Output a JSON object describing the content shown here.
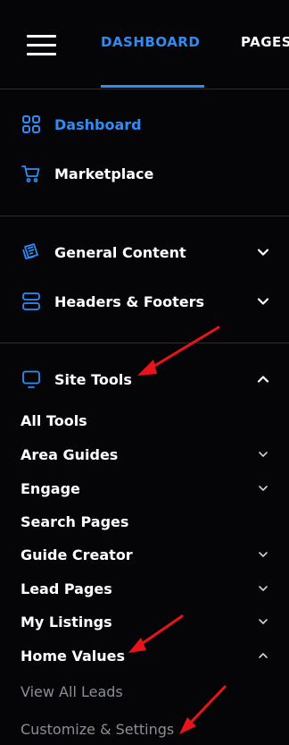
{
  "header": {
    "tabs": [
      {
        "label": "DASHBOARD",
        "active": true
      },
      {
        "label": "PAGES",
        "active": false
      }
    ]
  },
  "nav": {
    "primary": [
      {
        "label": "Dashboard",
        "icon": "grid-icon",
        "active": true
      },
      {
        "label": "Marketplace",
        "icon": "cart-icon",
        "active": false
      }
    ],
    "sections": [
      {
        "label": "General Content",
        "icon": "document-stack-icon",
        "expanded": false
      },
      {
        "label": "Headers & Footers",
        "icon": "layout-rows-icon",
        "expanded": false
      },
      {
        "label": "Site Tools",
        "icon": "monitor-icon",
        "expanded": true
      }
    ],
    "site_tools_items": [
      {
        "label": "All Tools",
        "expandable": false
      },
      {
        "label": "Area Guides",
        "expandable": true,
        "expanded": false
      },
      {
        "label": "Engage",
        "expandable": true,
        "expanded": false
      },
      {
        "label": "Search Pages",
        "expandable": false
      },
      {
        "label": "Guide Creator",
        "expandable": true,
        "expanded": false
      },
      {
        "label": "Lead Pages",
        "expandable": true,
        "expanded": false
      },
      {
        "label": "My Listings",
        "expandable": true,
        "expanded": false
      },
      {
        "label": "Home Values",
        "expandable": true,
        "expanded": true
      }
    ],
    "home_values_items": [
      {
        "label": "View All Leads"
      },
      {
        "label": "Customize & Settings"
      }
    ]
  },
  "colors": {
    "accent": "#2f8cf5",
    "background": "#050507",
    "muted_text": "#8b8e94",
    "annotation_arrow": "#e8141b"
  }
}
